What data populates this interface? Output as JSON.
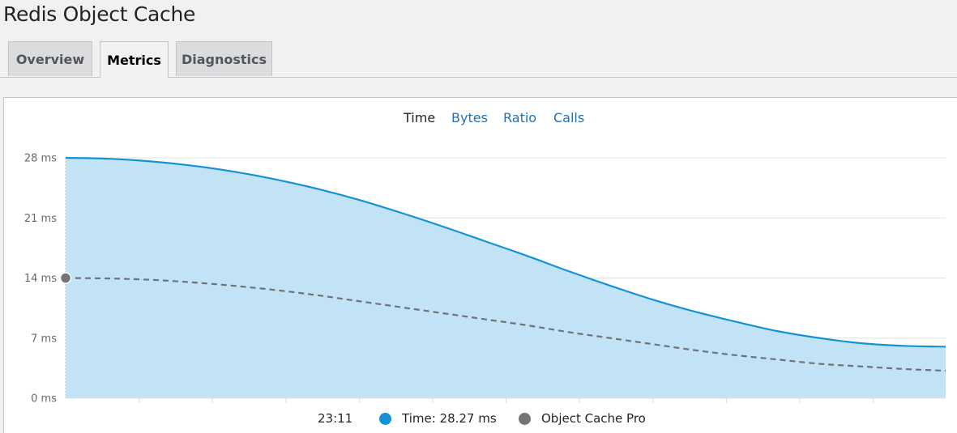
{
  "page": {
    "title": "Redis Object Cache"
  },
  "tabs": [
    {
      "label": "Overview",
      "active": false
    },
    {
      "label": "Metrics",
      "active": true
    },
    {
      "label": "Diagnostics",
      "active": false
    }
  ],
  "metric_tabs": [
    {
      "label": "Time",
      "current": true
    },
    {
      "label": "Bytes",
      "current": false
    },
    {
      "label": "Ratio",
      "current": false
    },
    {
      "label": "Calls",
      "current": false
    }
  ],
  "legend": {
    "time_label": "23:11",
    "series_a": "Time: 28.27 ms",
    "series_b": "Object Cache Pro"
  },
  "colors": {
    "series_a_line": "#1592d6",
    "series_a_fill": "#c2e3f5",
    "series_b_line": "#6f7378",
    "series_b_marker": "#757575"
  },
  "chart_data": {
    "type": "area",
    "ylim": [
      0,
      28
    ],
    "y_ticks": [
      0,
      7,
      14,
      21,
      28
    ],
    "y_tick_labels": [
      "0 ms",
      "7 ms",
      "21 ms",
      "14 ms",
      "28 ms"
    ],
    "series": [
      {
        "name": "Time",
        "style": "filled-area",
        "values": [
          28.0,
          27.9,
          27.6,
          27.1,
          26.4,
          25.5,
          24.4,
          23.1,
          21.6,
          20.0,
          18.3,
          16.6,
          14.8,
          13.1,
          11.5,
          10.1,
          8.9,
          7.8,
          7.0,
          6.4,
          6.1,
          6.0
        ]
      },
      {
        "name": "Object Cache Pro",
        "style": "dashed",
        "values": [
          14.0,
          13.95,
          13.8,
          13.5,
          13.1,
          12.6,
          12.0,
          11.3,
          10.6,
          9.9,
          9.2,
          8.5,
          7.7,
          7.0,
          6.3,
          5.6,
          5.0,
          4.5,
          4.0,
          3.7,
          3.4,
          3.2
        ]
      }
    ],
    "grid": true
  }
}
